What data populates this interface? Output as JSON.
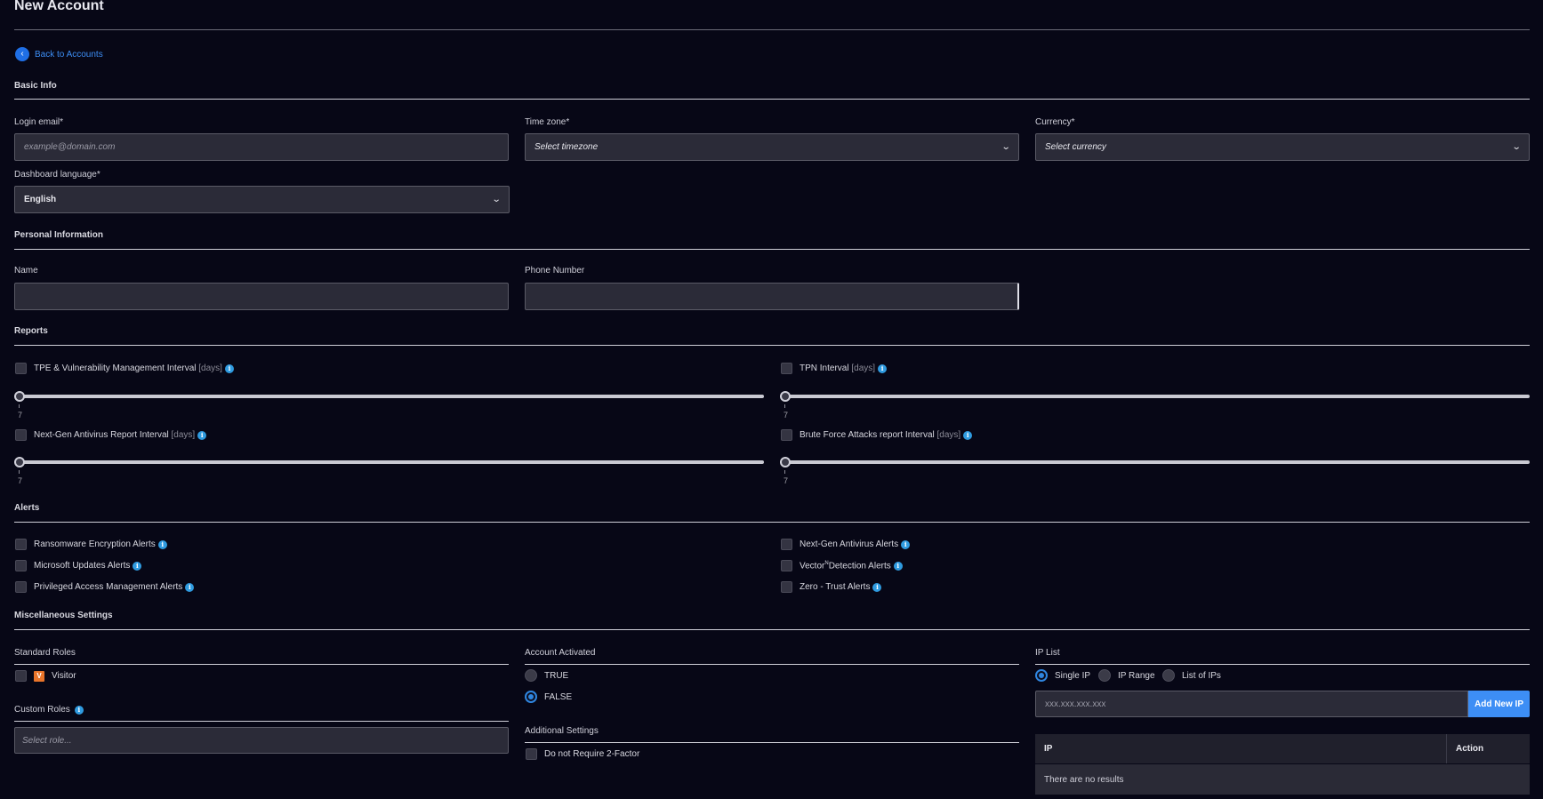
{
  "page": {
    "title": "New Account",
    "back_label": "Back to Accounts"
  },
  "basic_info": {
    "title": "Basic Info",
    "login_email": {
      "label": "Login email*",
      "placeholder": "example@domain.com"
    },
    "time_zone": {
      "label": "Time zone*",
      "value": "Select timezone"
    },
    "currency": {
      "label": "Currency*",
      "value": "Select currency"
    },
    "dashboard_language": {
      "label": "Dashboard language*",
      "value": "English"
    }
  },
  "personal_info": {
    "title": "Personal Information",
    "name_label": "Name",
    "phone_label": "Phone Number"
  },
  "reports": {
    "title": "Reports",
    "days_suffix": "[days]",
    "items": [
      {
        "label": "TPE & Vulnerability Management Interval",
        "value": "7",
        "checked": false
      },
      {
        "label": "TPN Interval",
        "value": "7",
        "checked": false
      },
      {
        "label": "Next-Gen Antivirus Report Interval",
        "value": "7",
        "checked": false
      },
      {
        "label": "Brute Force Attacks report Interval",
        "value": "7",
        "checked": false
      }
    ]
  },
  "alerts": {
    "title": "Alerts",
    "items": [
      {
        "label": "Ransomware Encryption Alerts",
        "checked": false
      },
      {
        "label": "Next-Gen Antivirus Alerts",
        "checked": false
      },
      {
        "label": "Microsoft Updates Alerts",
        "checked": false
      },
      {
        "label": "Vector",
        "label_sup": "N",
        "label_rest": "Detection Alerts",
        "checked": false
      },
      {
        "label": "Privileged Access Management Alerts",
        "checked": false
      },
      {
        "label": "Zero - Trust Alerts",
        "checked": false
      }
    ]
  },
  "misc": {
    "title": "Miscellaneous Settings",
    "standard_roles": {
      "title": "Standard Roles",
      "badge": "V",
      "role": "Visitor"
    },
    "custom_roles": {
      "title": "Custom Roles",
      "placeholder": "Select role..."
    },
    "account_activated": {
      "title": "Account Activated",
      "options": [
        "TRUE",
        "FALSE"
      ],
      "selected": "FALSE"
    },
    "additional_settings": {
      "title": "Additional Settings",
      "option": "Do not Require 2-Factor"
    },
    "ip_list": {
      "title": "IP List",
      "modes": [
        "Single IP",
        "IP Range",
        "List of IPs"
      ],
      "selected": "Single IP",
      "placeholder": "xxx.xxx.xxx.xxx",
      "add_button": "Add New IP",
      "columns": [
        "IP",
        "Action"
      ],
      "empty_text": "There are no results"
    }
  },
  "colors": {
    "accent": "#3d8ef5",
    "background": "#070716",
    "field_bg": "#2b2b38",
    "info_icon": "#2f9be0",
    "visitor_badge": "#e8742a"
  }
}
